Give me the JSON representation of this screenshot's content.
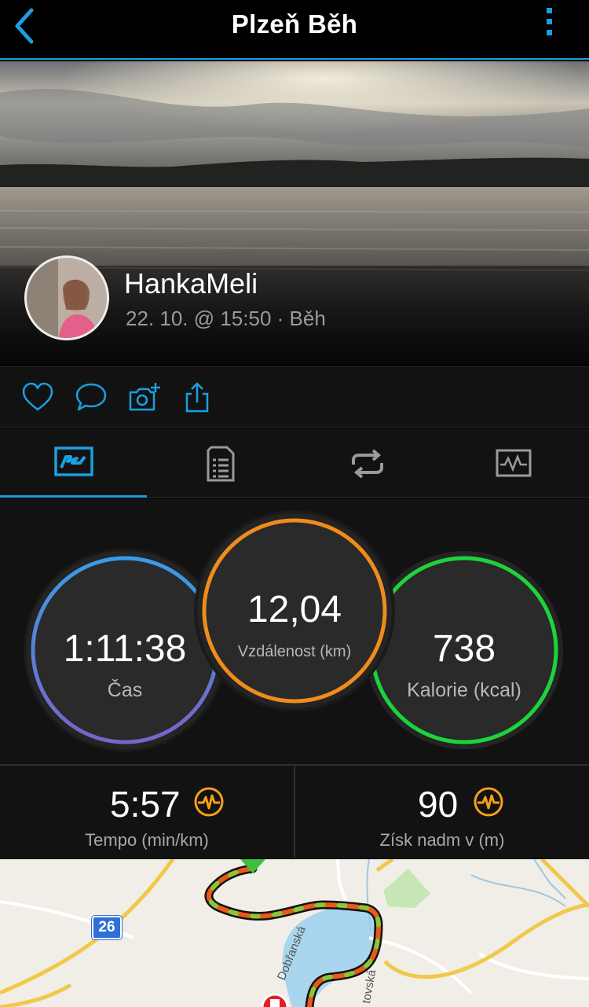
{
  "nav": {
    "title": "Plzeň Běh",
    "back_icon": "chevron-left-icon",
    "menu_icon": "more-vertical-icon",
    "accent": "#1aa0e0"
  },
  "activity": {
    "user_name": "HankaMeli",
    "meta": "22. 10. @ 15:50 · Běh"
  },
  "actions": [
    {
      "icon": "heart-icon"
    },
    {
      "icon": "comment-icon"
    },
    {
      "icon": "add-photo-icon"
    },
    {
      "icon": "share-icon"
    }
  ],
  "tabs": [
    {
      "icon": "summary-map-icon",
      "active": true
    },
    {
      "icon": "details-list-icon",
      "active": false
    },
    {
      "icon": "laps-icon",
      "active": false
    },
    {
      "icon": "charts-icon",
      "active": false
    }
  ],
  "stats": {
    "time": {
      "value": "1:11:38",
      "label": "Čas"
    },
    "distance": {
      "value": "12,04",
      "label": "Vzdálenost (km)"
    },
    "calories": {
      "value": "738",
      "label": "Kalorie (kcal)"
    }
  },
  "metrics": {
    "pace": {
      "value": "5:57",
      "label": "Tempo (min/km)",
      "icon": "heartbeat-badge-icon"
    },
    "elevation": {
      "value": "90",
      "label": "Získ nadm v (m)",
      "icon": "heartbeat-badge-icon"
    }
  },
  "map": {
    "road_number": "26",
    "street_1": "Dobřanská",
    "street_2": "tovská"
  },
  "colors": {
    "time_ring": [
      "#3a9be8",
      "#7b63c8"
    ],
    "distance_ring": "#f08c1c",
    "calories_ring": "#1ed33a",
    "badge": "#f5a01a"
  }
}
